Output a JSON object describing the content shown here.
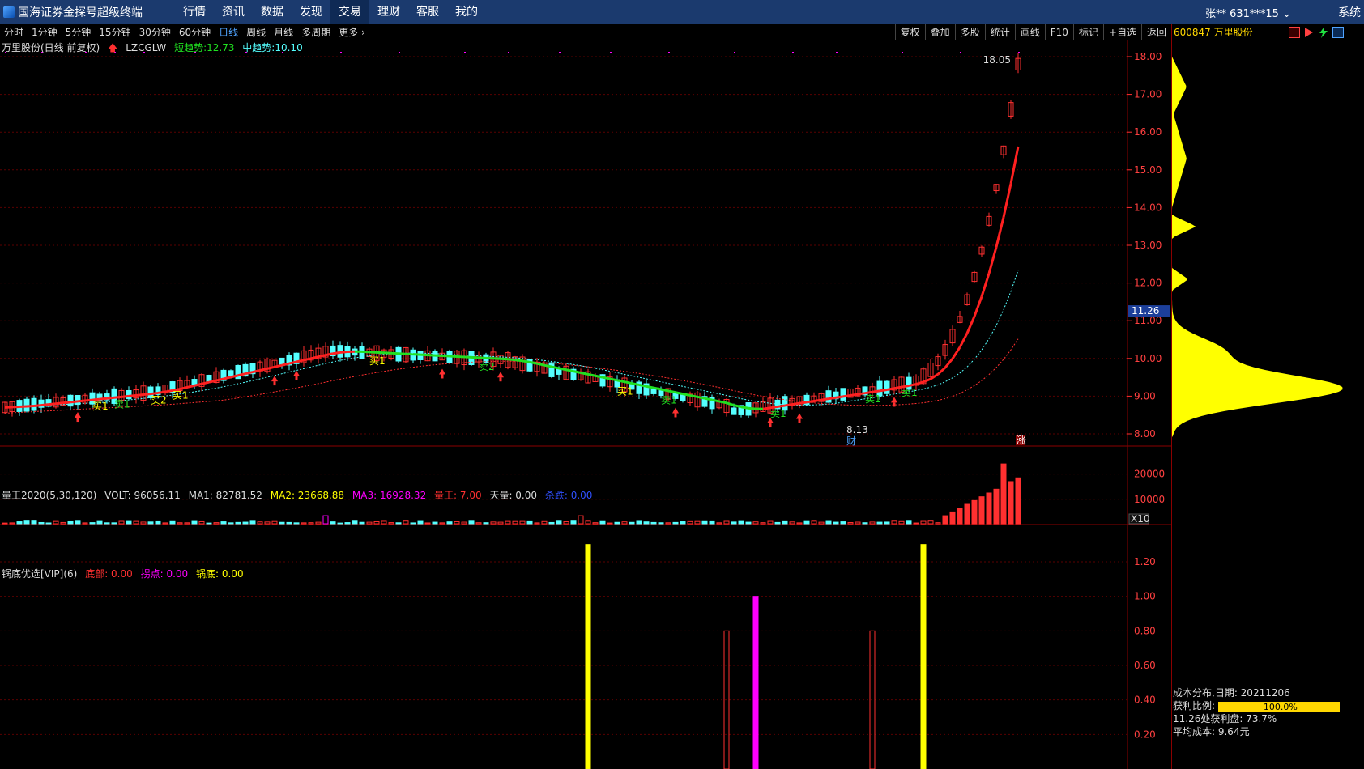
{
  "app": {
    "title": "国海证券金探号超级终端",
    "menu": [
      "行情",
      "资讯",
      "数据",
      "发现",
      "交易",
      "理财",
      "客服",
      "我的"
    ],
    "active_menu": "交易",
    "user": "张** 631***15",
    "system": "系统"
  },
  "periods": [
    "分时",
    "1分钟",
    "5分钟",
    "15分钟",
    "30分钟",
    "60分钟",
    "日线",
    "周线",
    "月线",
    "多周期",
    "更多"
  ],
  "active_period": "日线",
  "tools": [
    "复权",
    "叠加",
    "多股",
    "统计",
    "画线",
    "F10",
    "标记",
    "+自选",
    "返回"
  ],
  "stock": {
    "code_name": "600847 万里股份"
  },
  "main_panel": {
    "title": "万里股份(日线 前复权)",
    "indicator": "LZCGLW",
    "short_trend_label": "短趋势:",
    "short_trend_value": "12.73",
    "mid_trend_label": "中趋势:",
    "mid_trend_value": "10.10",
    "high_label": "18.05",
    "low_label": "8.13",
    "price_ticks": [
      "18.00",
      "17.00",
      "16.00",
      "15.00",
      "14.00",
      "13.00",
      "12.00",
      "11.00",
      "10.00",
      "9.00",
      "8.00"
    ],
    "current_price": "11.26",
    "markers": {
      "cai": "财",
      "zhang": "涨"
    },
    "signals": [
      "买1",
      "买2",
      "买1",
      "卖2",
      "买1",
      "卖1",
      "卖1",
      "卖1",
      "卖1",
      "卖1",
      "买1"
    ]
  },
  "volume_panel": {
    "title": "量王2020(5,30,120)",
    "volt": "VOLT: 96056.11",
    "ma1": "MA1: 82781.52",
    "ma2": "MA2: 23668.88",
    "ma3": "MA3: 16928.32",
    "liangwang": "量王: 7.00",
    "tianliang": "天量: 0.00",
    "chaodie": "杀跌: 0.00",
    "ticks": [
      "20000",
      "10000"
    ],
    "unit": "X10"
  },
  "bottom_panel": {
    "title": "锅底优选[VIP](6)",
    "dibu": "底部: 0.00",
    "guaidian": "拐点: 0.00",
    "guodi": "锅底: 0.00",
    "ticks": [
      "1.20",
      "1.00",
      "0.80",
      "0.60",
      "0.40",
      "0.20"
    ]
  },
  "cost_info": {
    "line1": "成本分布,日期: 20211206",
    "line2_label": "获利比例:",
    "profit_ratio": "100.0%",
    "profit_ratio_value": 1.0,
    "line3": "11.26处获利盘: 73.7%",
    "line4": "平均成本: 9.64元"
  },
  "colors": {
    "up": "#ff3030",
    "down": "#54ffff",
    "short_trend": "#ff2020",
    "mid_trend": "#20e020",
    "yellow": "#ffff00",
    "magenta": "#ff00ff"
  }
}
